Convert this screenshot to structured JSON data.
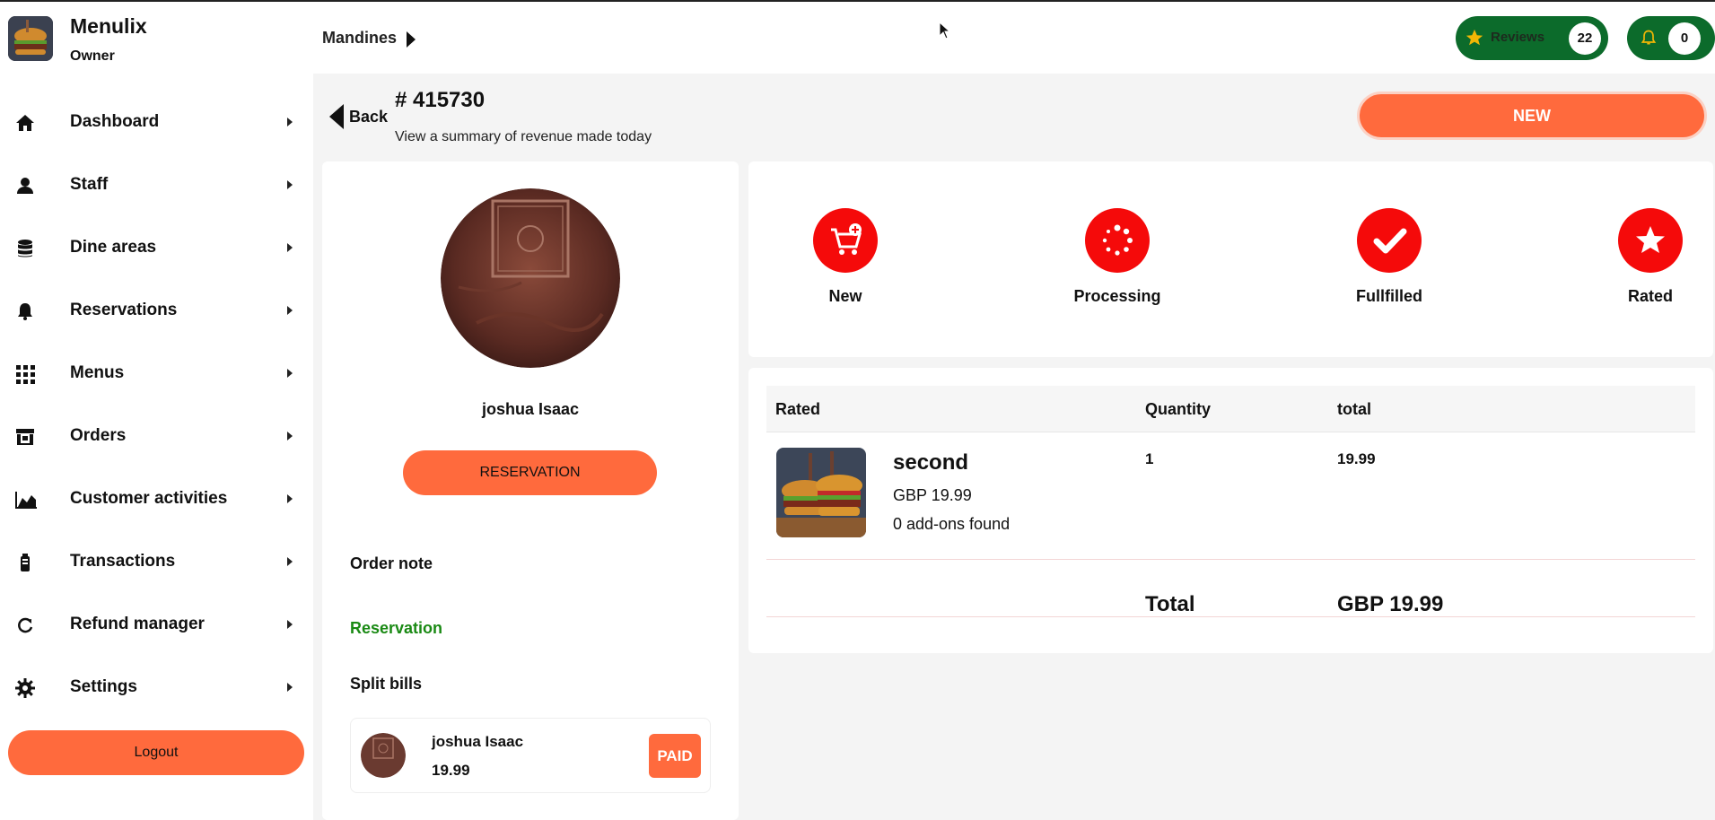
{
  "app": {
    "name": "Menulix",
    "role": "Owner"
  },
  "sidebar": {
    "items": [
      {
        "label": "Dashboard",
        "icon": "home-icon"
      },
      {
        "label": "Staff",
        "icon": "person-icon"
      },
      {
        "label": "Dine areas",
        "icon": "database-icon"
      },
      {
        "label": "Reservations",
        "icon": "bell-icon"
      },
      {
        "label": "Menus",
        "icon": "grid-icon"
      },
      {
        "label": "Orders",
        "icon": "store-icon"
      },
      {
        "label": "Customer activities",
        "icon": "area-chart-icon"
      },
      {
        "label": "Transactions",
        "icon": "battery-icon"
      },
      {
        "label": "Refund manager",
        "icon": "refresh-icon"
      },
      {
        "label": "Settings",
        "icon": "gear-icon"
      }
    ],
    "logout_label": "Logout"
  },
  "header": {
    "breadcrumb": "Mandines",
    "reviews_label": "Reviews",
    "reviews_count": "22",
    "notifications_count": "0"
  },
  "order": {
    "back_label": "Back",
    "number": "# 415730",
    "subtitle": "View a summary of revenue made today",
    "status_button": "NEW"
  },
  "customer": {
    "name": "joshua Isaac",
    "reservation_button": "RESERVATION",
    "order_note_label": "Order note",
    "reservation_link": "Reservation",
    "split_bills_label": "Split bills",
    "split": {
      "name": "joshua Isaac",
      "amount": "19.99",
      "status": "PAID"
    }
  },
  "statuses": [
    {
      "label": "New",
      "icon": "cart-add-icon"
    },
    {
      "label": "Processing",
      "icon": "spinner-icon"
    },
    {
      "label": "Fullfilled",
      "icon": "check-icon"
    },
    {
      "label": "Rated",
      "icon": "star-icon"
    }
  ],
  "table": {
    "headers": [
      "Rated",
      "Quantity",
      "total"
    ],
    "items": [
      {
        "name": "second",
        "price": "GBP  19.99",
        "addons": "0 add-ons found",
        "quantity": "1",
        "total": "19.99"
      }
    ],
    "total_label": "Total",
    "total_value": "GBP  19.99"
  },
  "colors": {
    "accent": "#ff6a3d",
    "status_red": "#f50a0a",
    "pill_green": "#0c6b2b",
    "link_green": "#1a8a14"
  }
}
